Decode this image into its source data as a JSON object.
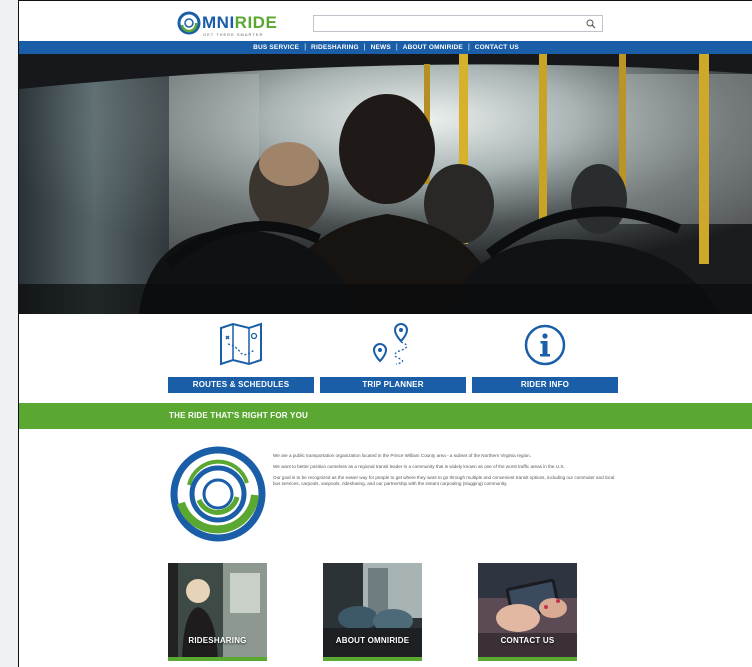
{
  "brand": {
    "logo_main": "MNI",
    "logo_accent": "RIDE",
    "tagline": "GET THERE SMARTER",
    "primary_color": "#1b5ea8",
    "accent_color": "#5aa832"
  },
  "search": {
    "placeholder": "",
    "icon": "search-icon"
  },
  "nav": {
    "items": [
      {
        "label": "BUS SERVICE"
      },
      {
        "label": "RIDESHARING"
      },
      {
        "label": "NEWS"
      },
      {
        "label": "ABOUT OMNIRIDE"
      },
      {
        "label": "CONTACT US"
      }
    ],
    "separator": "|"
  },
  "quick_links": [
    {
      "label": "ROUTES & SCHEDULES",
      "icon": "map-icon"
    },
    {
      "label": "TRIP PLANNER",
      "icon": "route-pins-icon"
    },
    {
      "label": "RIDER INFO",
      "icon": "info-icon"
    }
  ],
  "section": {
    "title": "THE RIDE THAT'S RIGHT FOR YOU"
  },
  "about": {
    "paragraphs": [
      "We are a public transportation organization located in the Prince William County area - a subset of the Northern Virginia region.",
      "We want to better position ourselves as a regional transit leader in a community that is widely known as one of the worst traffic areas in the U.S.",
      "Our goal is to be recognized as the easier way for people to get where they want to go through multiple and convenient transit options, including our commuter and local bus services, carpools, vanpools, ridesharing, and our partnership with the instant carpooling (slugging) community."
    ]
  },
  "tiles": [
    {
      "label": "RIDESHARING"
    },
    {
      "label": "ABOUT OMNIRIDE"
    },
    {
      "label": "CONTACT US"
    }
  ]
}
